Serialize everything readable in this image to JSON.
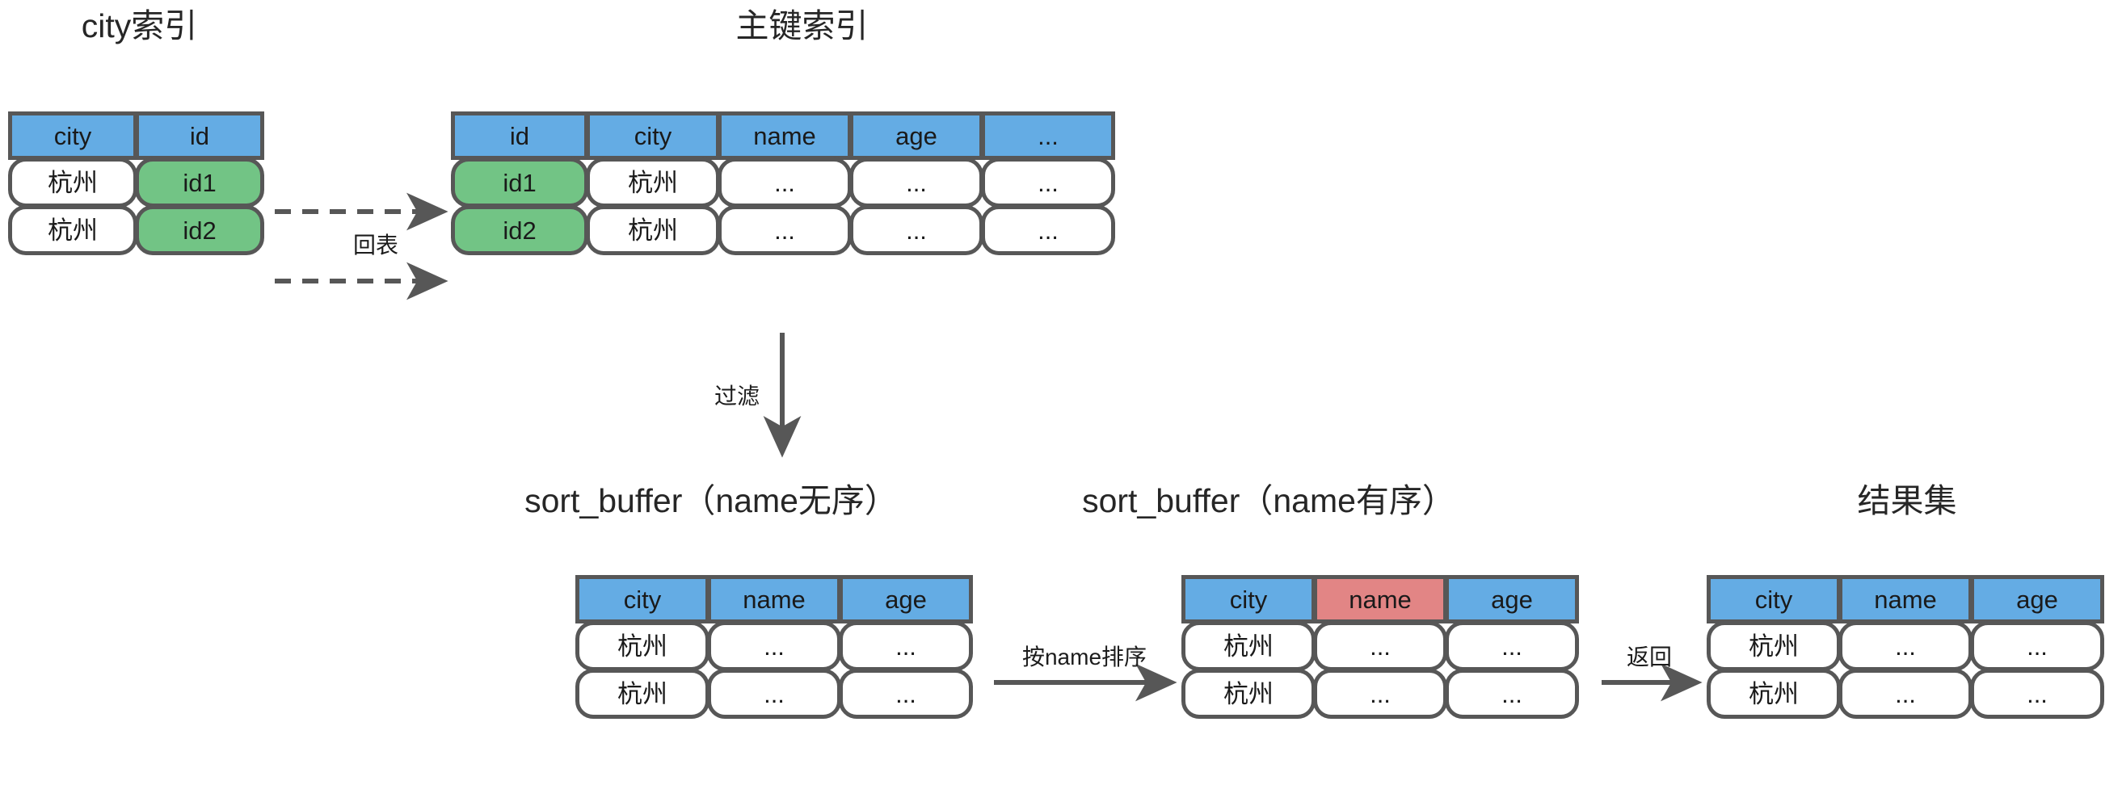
{
  "diagram": {
    "title_city_index": "city索引",
    "title_primary_index": "主键索引",
    "title_sort_buffer_unsorted": "sort_buffer（name无序）",
    "title_sort_buffer_sorted": "sort_buffer（name有序）",
    "title_result_set": "结果集",
    "colors": {
      "header_blue": "#64ACE4",
      "header_accent_red": "#E28585",
      "cell_green": "#72C485",
      "border_gray": "#575757",
      "background": "#ffffff",
      "text": "#1c1c1c"
    }
  },
  "tables": {
    "city_index": {
      "headers": [
        "city",
        "id"
      ],
      "rows": [
        [
          "杭州",
          "id1"
        ],
        [
          "杭州",
          "id2"
        ]
      ],
      "highlighted_column_index": 1
    },
    "primary_index": {
      "headers": [
        "id",
        "city",
        "name",
        "age",
        "..."
      ],
      "rows": [
        [
          "id1",
          "杭州",
          "...",
          "...",
          "..."
        ],
        [
          "id2",
          "杭州",
          "...",
          "...",
          "..."
        ]
      ],
      "highlighted_column_index": 0
    },
    "sort_buffer_unsorted": {
      "headers": [
        "city",
        "name",
        "age"
      ],
      "rows": [
        [
          "杭州",
          "...",
          "..."
        ],
        [
          "杭州",
          "...",
          "..."
        ]
      ],
      "accent_header_index": -1
    },
    "sort_buffer_sorted": {
      "headers": [
        "city",
        "name",
        "age"
      ],
      "rows": [
        [
          "杭州",
          "...",
          "..."
        ],
        [
          "杭州",
          "...",
          "..."
        ]
      ],
      "accent_header_index": 1
    },
    "result_set": {
      "headers": [
        "city",
        "name",
        "age"
      ],
      "rows": [
        [
          "杭州",
          "...",
          "..."
        ],
        [
          "杭州",
          "...",
          "..."
        ]
      ],
      "accent_header_index": -1
    }
  },
  "connectors": {
    "lookup_table": "回表",
    "filter": "过滤",
    "sort_by_name": "按name排序",
    "return": "返回"
  }
}
